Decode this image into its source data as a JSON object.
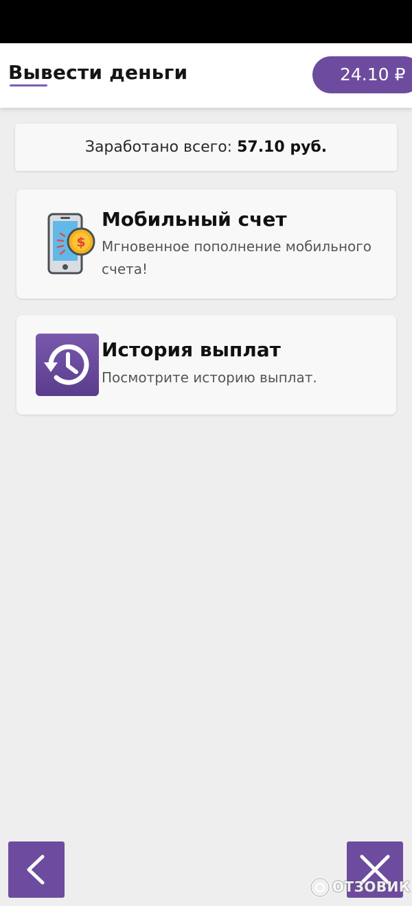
{
  "header": {
    "title": "Вывести деньги",
    "balance": "24.10 ₽"
  },
  "earned": {
    "label": "Заработано всего:",
    "value": "57.10 руб."
  },
  "options": [
    {
      "title": "Мобильный счет",
      "description": "Мгновенное пополнение мобильного счета!",
      "icon": "phone-coin-icon"
    },
    {
      "title": "История выплат",
      "description": "Посмотрите историю выплат.",
      "icon": "history-icon"
    }
  ],
  "navigation": {
    "back_icon": "chevron-left-icon",
    "close_icon": "close-icon"
  },
  "watermark": {
    "text": "ОТЗОВИК"
  },
  "colors": {
    "accent": "#6d4c9f",
    "background": "#eeeeee",
    "card": "#f8f8f8"
  }
}
